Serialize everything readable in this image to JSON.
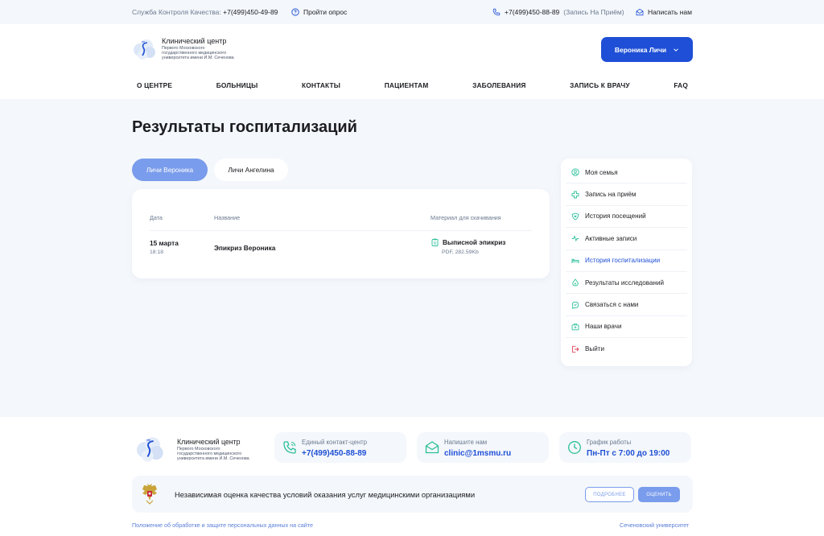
{
  "topbar": {
    "quality_label": "Служба Контроля Качества:",
    "quality_phone": "+7(499)450-49-89",
    "survey": "Пройти опрос",
    "phone": "+7(499)450-88-89",
    "phone_note": "(Запись На Приём)",
    "write": "Написать нам"
  },
  "logo": {
    "title": "Клинический центр",
    "subtitle": "Первого Московского государственного медицинского университета имени И.М. Сеченова"
  },
  "user_button": "Вероника Личи",
  "nav": [
    "О ЦЕНТРЕ",
    "БОЛЬНИЦЫ",
    "КОНТАКТЫ",
    "ПАЦИЕНТАМ",
    "ЗАБОЛЕВАНИЯ",
    "ЗАПИСЬ К ВРАЧУ",
    "FAQ"
  ],
  "page_title": "Результаты госпитализаций",
  "tabs": [
    {
      "label": "Личи Вероника"
    },
    {
      "label": "Личи Ангелина"
    }
  ],
  "table": {
    "headers": {
      "date": "Дата",
      "name": "Название",
      "material": "Материал для скачивания"
    },
    "rows": [
      {
        "date": "15 марта",
        "time": "18:18",
        "name": "Эпикриз Вероника",
        "file": "Выписной эпикриз",
        "meta": "PDF, 282.59Kb"
      }
    ]
  },
  "sidebar": {
    "items": [
      {
        "label": "Моя семья",
        "icon": "user-circle-icon"
      },
      {
        "label": "Запись на приём",
        "icon": "medical-cross-icon"
      },
      {
        "label": "История посещений",
        "icon": "heart-shield-icon"
      },
      {
        "label": "Активные записи",
        "icon": "pulse-icon"
      },
      {
        "label": "История госпитализации",
        "icon": "bed-icon"
      },
      {
        "label": "Результаты исследований",
        "icon": "drop-icon"
      },
      {
        "label": "Связаться с нами",
        "icon": "chat-icon"
      },
      {
        "label": "Наши врачи",
        "icon": "medkit-icon"
      },
      {
        "label": "Выйти",
        "icon": "logout-icon"
      }
    ],
    "active_index": 4
  },
  "footer": {
    "contact_label": "Единый контакт-центр",
    "contact_value": "+7(499)450-88-89",
    "write_label": "Напишите нам",
    "write_value": "clinic@1msmu.ru",
    "hours_label": "График работы",
    "hours_value": "Пн-Пт с 7:00 до 19:00",
    "quality_text": "Независимая оценка качества условий оказания услуг медицинскими организациями",
    "more_button": "ПОДРОБНЕЕ",
    "rate_button": "ОЦЕНИТЬ",
    "privacy_link": "Положение об обработке и защите персональных данных на сайте",
    "university_link": "Сеченовский университет"
  },
  "colors": {
    "accent": "#1e4fd6",
    "accent_light": "#7a9cec",
    "icon_green": "#2bbf9a",
    "logout_red": "#e0475b",
    "page_bg": "#f4f7fb"
  }
}
